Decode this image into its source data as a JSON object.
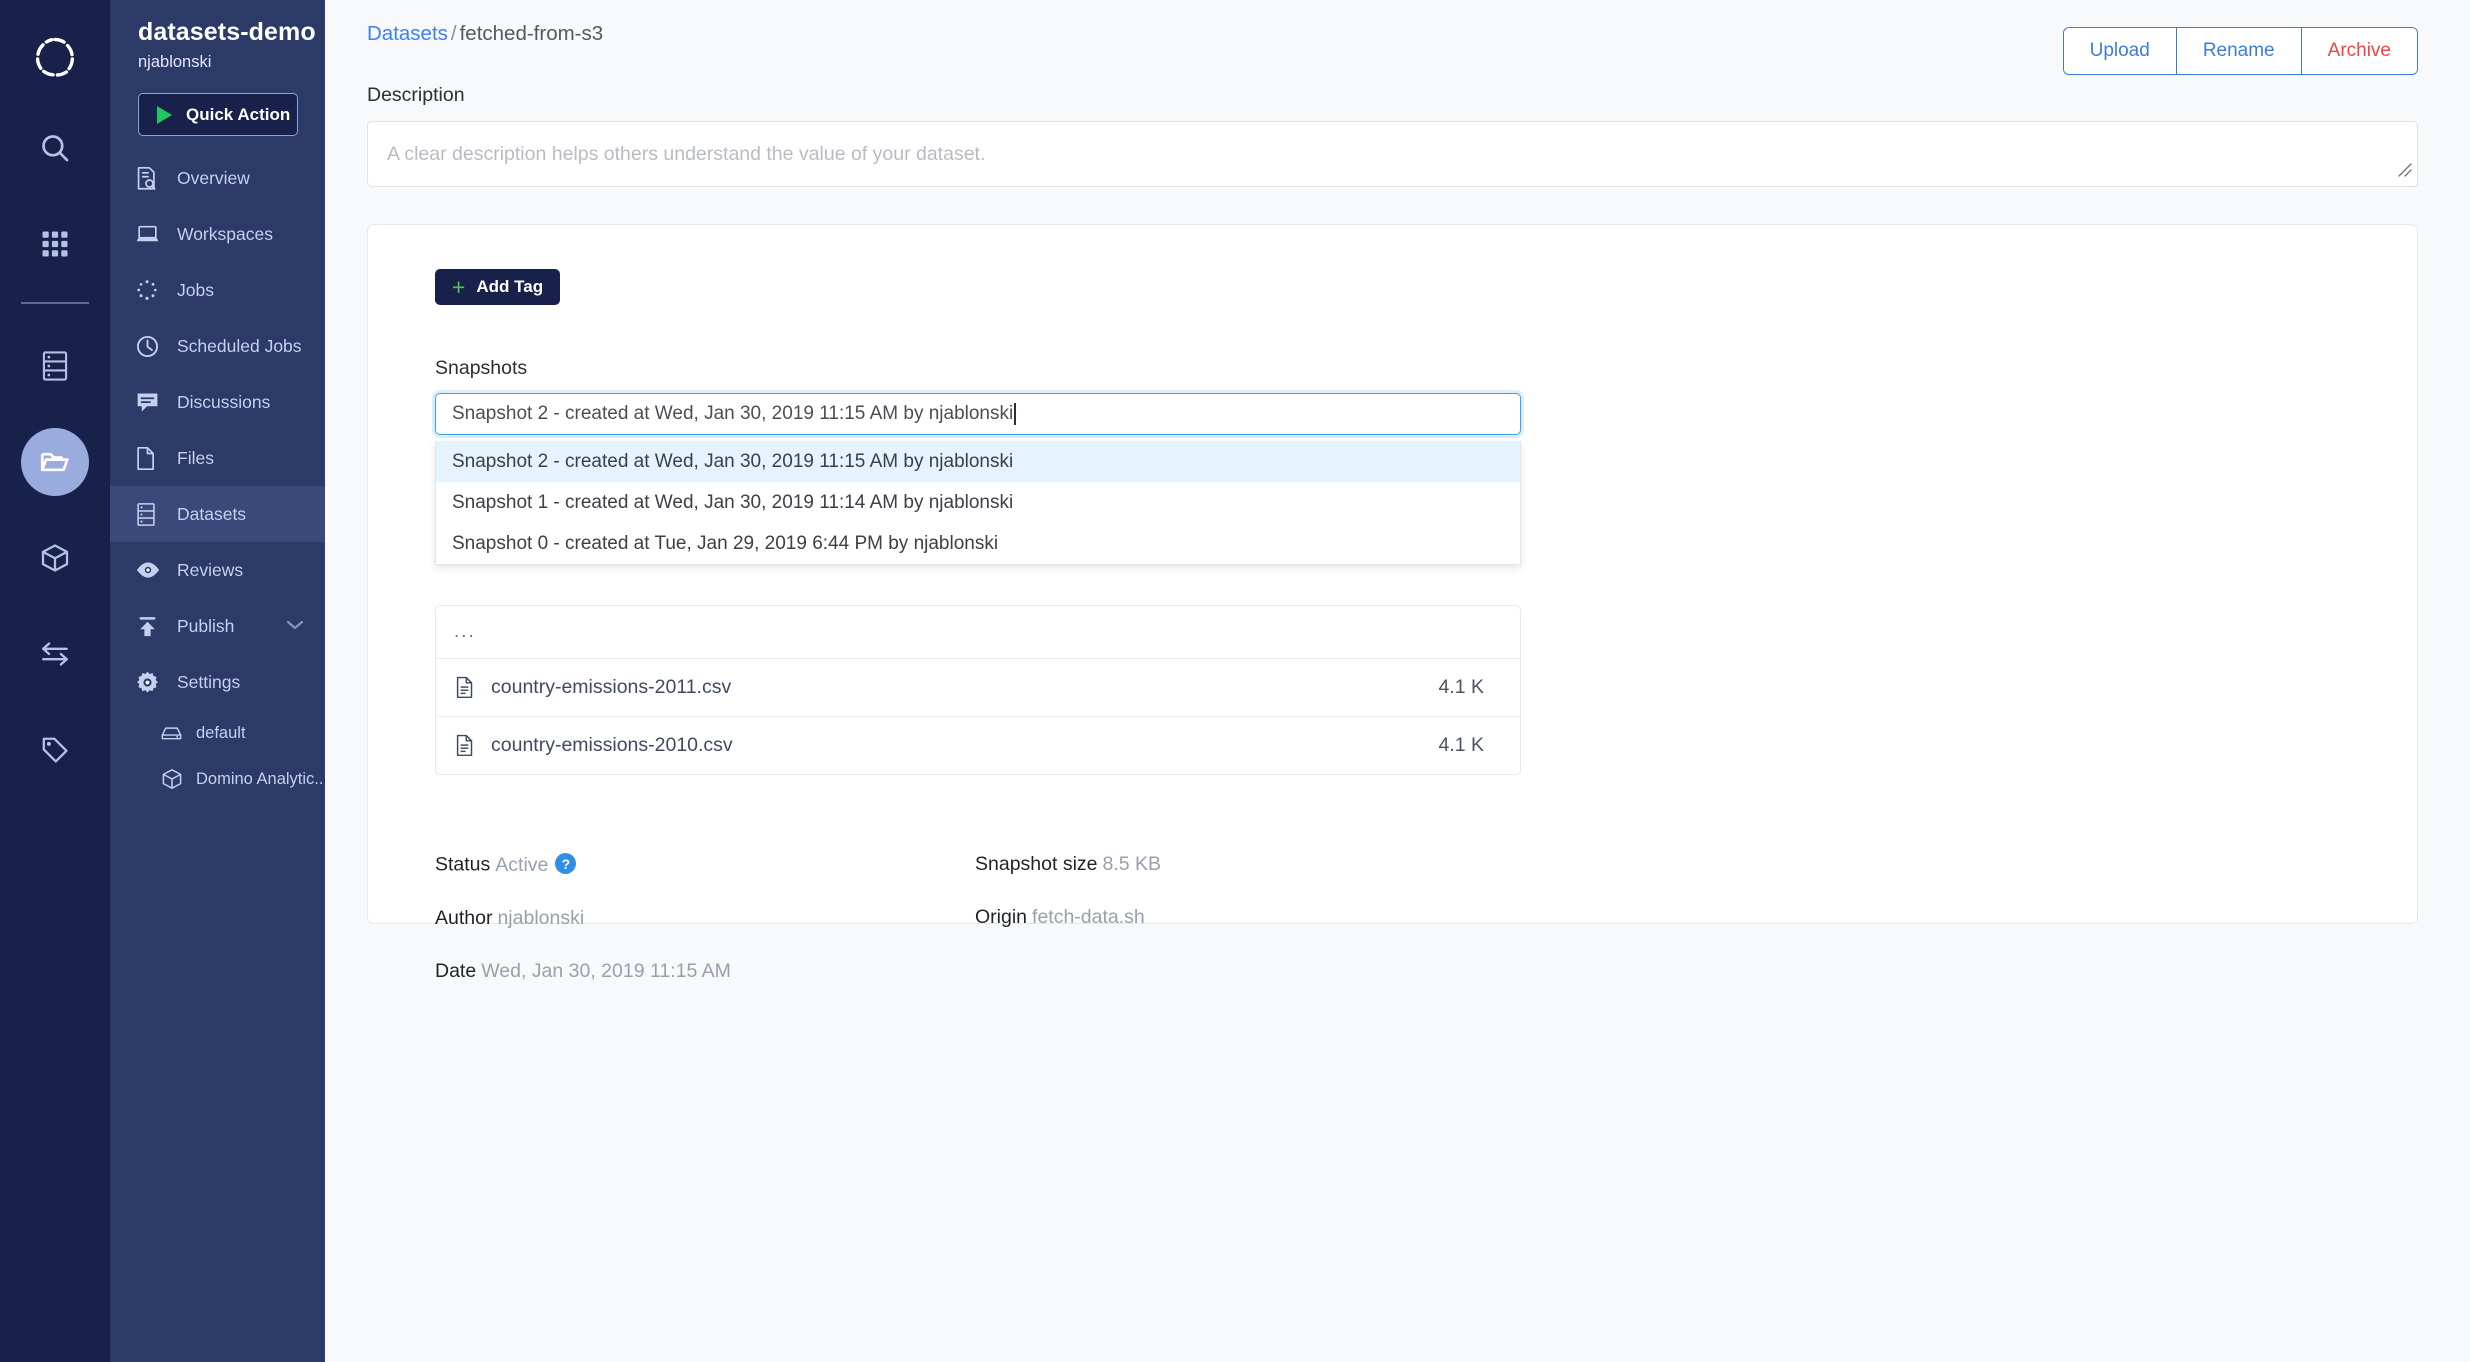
{
  "rail": {
    "logo": "domino-logo-icon",
    "items": [
      {
        "name": "search-icon"
      },
      {
        "name": "grid-apps-icon"
      },
      {
        "name": "server-data-icon"
      },
      {
        "name": "folder-icon",
        "active": true
      },
      {
        "name": "cube-environments-icon"
      },
      {
        "name": "transfer-arrows-icon"
      },
      {
        "name": "tag-icon"
      }
    ]
  },
  "sidebar": {
    "project_title": "datasets-demo",
    "project_owner": "njablonski",
    "quick_action_label": "Quick Action",
    "items": [
      {
        "label": "Overview",
        "icon": "overview-icon",
        "active": false
      },
      {
        "label": "Workspaces",
        "icon": "laptop-icon",
        "active": false
      },
      {
        "label": "Jobs",
        "icon": "spinner-dots-icon",
        "active": false
      },
      {
        "label": "Scheduled Jobs",
        "icon": "clock-icon",
        "active": false
      },
      {
        "label": "Discussions",
        "icon": "chat-bubble-icon",
        "active": false
      },
      {
        "label": "Files",
        "icon": "file-icon",
        "active": false
      },
      {
        "label": "Datasets",
        "icon": "server-data-icon",
        "active": true
      },
      {
        "label": "Reviews",
        "icon": "eye-icon",
        "active": false
      },
      {
        "label": "Publish",
        "icon": "publish-upload-icon",
        "active": false,
        "chevron": true
      },
      {
        "label": "Settings",
        "icon": "gear-icon",
        "active": false
      }
    ],
    "sub_items": [
      {
        "label": "default",
        "icon": "hard-drive-icon"
      },
      {
        "label": "Domino Analytic...",
        "icon": "cube-icon"
      }
    ]
  },
  "header": {
    "breadcrumb_root": "Datasets",
    "breadcrumb_separator": "/",
    "breadcrumb_current": "fetched-from-s3",
    "actions": [
      {
        "label": "Upload",
        "style": "primary"
      },
      {
        "label": "Rename",
        "style": "primary"
      },
      {
        "label": "Archive",
        "style": "danger"
      }
    ]
  },
  "description": {
    "label": "Description",
    "value": "",
    "placeholder": "A clear description helps others understand the value of your dataset."
  },
  "card": {
    "add_tag_label": "Add Tag",
    "add_tag_plus": "+",
    "snapshots_label": "Snapshots",
    "combo_value": "Snapshot 2 - created at Wed, Jan 30, 2019 11:15 AM by njablonski",
    "dropdown_options": [
      {
        "label": "Snapshot 2 - created at Wed, Jan 30, 2019 11:15 AM by njablonski",
        "selected": true
      },
      {
        "label": "Snapshot 1 - created at Wed, Jan 30, 2019 11:14 AM by njablonski",
        "selected": false
      },
      {
        "label": "Snapshot 0 - created at Tue, Jan 29, 2019 6:44 PM by njablonski",
        "selected": false
      }
    ],
    "file_ellipsis": "...",
    "files": [
      {
        "name": "country-emissions-2011.csv",
        "size": "4.1 K"
      },
      {
        "name": "country-emissions-2010.csv",
        "size": "4.1 K"
      }
    ],
    "meta": {
      "status_label": "Status",
      "status_value": "Active",
      "author_label": "Author",
      "author_value": "njablonski",
      "date_label": "Date",
      "date_value": "Wed, Jan 30, 2019 11:15 AM",
      "snapshot_size_label": "Snapshot size",
      "snapshot_size_value": "8.5 KB",
      "origin_label": "Origin",
      "origin_value": "fetch-data.sh",
      "help_glyph": "?"
    }
  },
  "colors": {
    "rail_bg": "#17214a",
    "sidebar_bg": "#2c3a67",
    "sidebar_active": "#3b497a",
    "accent_blue": "#3b82f6",
    "danger_red": "#ef4444",
    "green": "#54c24a",
    "focus_blue": "#3ba0ec",
    "dropdown_selected": "#e4f3fc"
  }
}
